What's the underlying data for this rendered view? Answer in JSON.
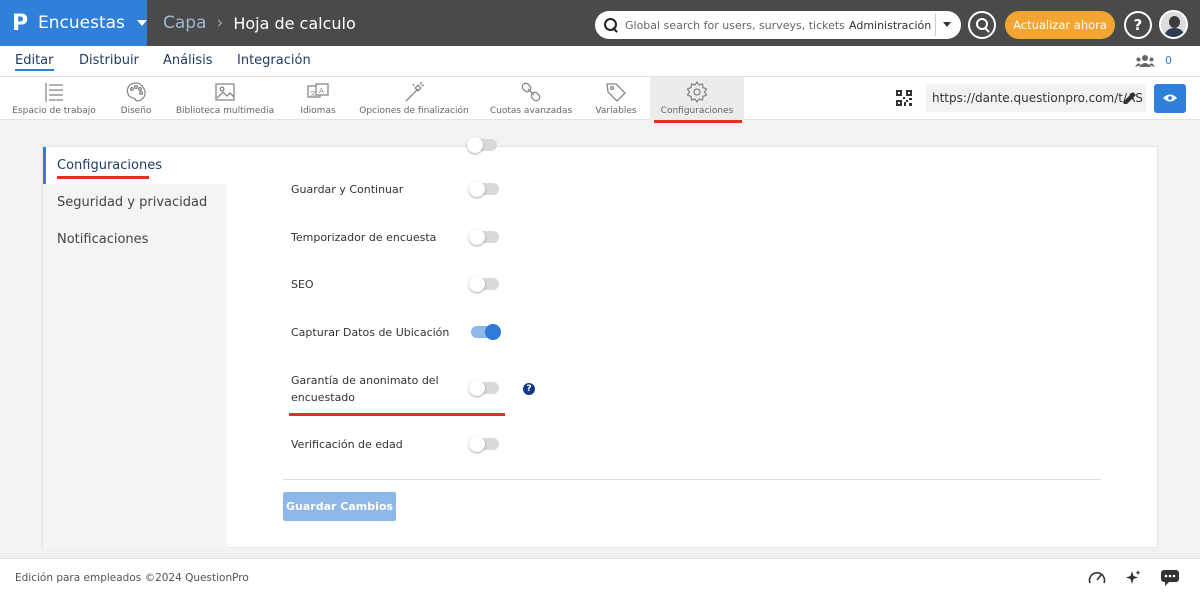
{
  "topbar": {
    "brand_name": "Encuestas",
    "breadcrumb_parent": "Capa",
    "breadcrumb_current": "Hoja de calculo",
    "search_placeholder": "Global search for users, surveys, tickets",
    "search_scope": "Administración",
    "upgrade_label": "Actualizar ahora",
    "help_label": "?"
  },
  "mainnav": {
    "items": [
      {
        "label": "Editar",
        "active": true
      },
      {
        "label": "Distribuir",
        "active": false
      },
      {
        "label": "Análisis",
        "active": false
      },
      {
        "label": "Integración",
        "active": false
      }
    ],
    "collaborator_count": "0"
  },
  "toolbar": {
    "items": [
      {
        "label": "Espacio de trabajo",
        "icon": "workspace-icon"
      },
      {
        "label": "Diseño",
        "icon": "palette-icon"
      },
      {
        "label": "Biblioteca multimedia",
        "icon": "image-icon"
      },
      {
        "label": "Idiomas",
        "icon": "language-icon"
      },
      {
        "label": "Opciones de finalización",
        "icon": "magic-wand-icon"
      },
      {
        "label": "Cuotas avanzadas",
        "icon": "link-chain-icon"
      },
      {
        "label": "Variables",
        "icon": "tag-icon"
      },
      {
        "label": "Configuraciones",
        "icon": "gear-icon",
        "active": true
      }
    ],
    "survey_url": "https://dante.questionpro.com/t/AS"
  },
  "sidebar": {
    "items": [
      {
        "label": "Configuraciones",
        "active": true
      },
      {
        "label": "Seguridad y privacidad",
        "active": false
      },
      {
        "label": "Notificaciones",
        "active": false
      }
    ]
  },
  "settings": [
    {
      "label": "Guardar y Continuar",
      "enabled": false
    },
    {
      "label": "Temporizador de encuesta",
      "enabled": false
    },
    {
      "label": "SEO",
      "enabled": false
    },
    {
      "label": "Capturar Datos de Ubicación",
      "enabled": true
    },
    {
      "label_line1": "Garantía de anonimato del",
      "label_line2": "encuestado",
      "enabled": false,
      "has_help": true
    },
    {
      "label": "Verificación de edad",
      "enabled": false
    }
  ],
  "save_label": "Guardar Cambios",
  "footer": {
    "copyright": "Edición para empleados ©2024 QuestionPro"
  },
  "colors": {
    "brand_blue": "#2f80d9",
    "topbar": "#4a4a4a",
    "upgrade_orange": "#f2a531",
    "highlight_red": "#e03020"
  }
}
